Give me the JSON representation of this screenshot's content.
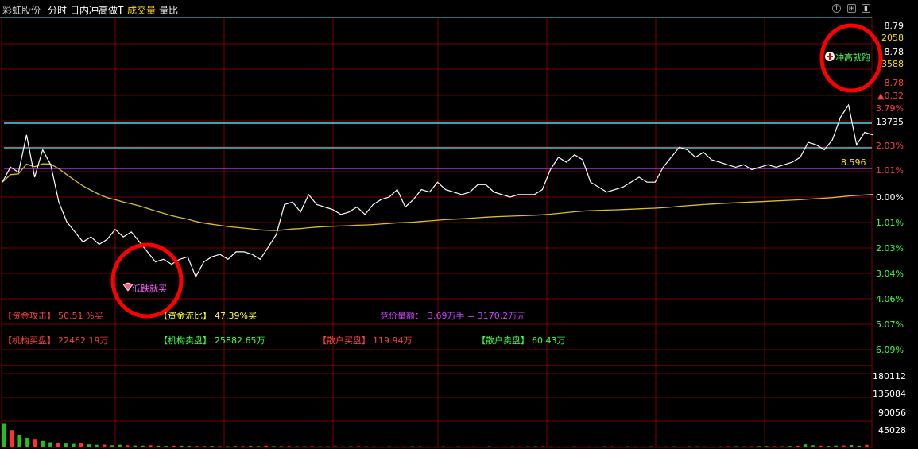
{
  "header": {
    "stock_name": "彩虹股份",
    "tabs": [
      "分时",
      "日内冲高做T",
      "成交量",
      "量比"
    ],
    "tab_colors": [
      "#ffffff",
      "#ffffff",
      "#ffdd00",
      "#ffffff"
    ]
  },
  "overlay_signals": {
    "high_signal": "冲高就跑",
    "low_signal": "低跌就买"
  },
  "info_rows": {
    "row1": [
      {
        "label": "【资金攻击】",
        "value": "50.51 %买",
        "color": "#ff4040"
      },
      {
        "label": "【资金流比】",
        "value": "47.39%买",
        "color": "#ffff40"
      },
      {
        "label": "竞价量额：",
        "value": "3.69万手 = 3170.2万元",
        "color": "#d040ff"
      }
    ],
    "row2": [
      {
        "label": "【机构买盘】",
        "value": "22462.19万",
        "color": "#ff4040"
      },
      {
        "label": "【机构卖盘】",
        "value": "25882.65万",
        "color": "#40ff40"
      },
      {
        "label": "【散户买盘】",
        "value": "119.94万",
        "color": "#ff4040"
      },
      {
        "label": "【散户卖盘】",
        "value": "60.43万",
        "color": "#40ff40"
      }
    ]
  },
  "right_axis": {
    "top_labels": [
      {
        "text": "8.79",
        "color": "#ffffff"
      },
      {
        "text": "2058",
        "color": "#ffdd00"
      },
      {
        "text": "8.78",
        "color": "#ffffff"
      },
      {
        "text": "3588",
        "color": "#ffdd00"
      },
      {
        "text": "8.78",
        "color": "#ff4040"
      },
      {
        "text": "▲0.32",
        "color": "#ff4040"
      },
      {
        "text": "3.79%",
        "color": "#ff4040"
      },
      {
        "text": "13735",
        "color": "#ffffff"
      }
    ],
    "pct_labels": [
      {
        "text": "2.03%",
        "color": "#ff4040"
      },
      {
        "text": "1.01%",
        "color": "#ff4040"
      },
      {
        "text": "0.00%",
        "color": "#ffffff"
      },
      {
        "text": "1.01%",
        "color": "#40ff40"
      },
      {
        "text": "2.03%",
        "color": "#40ff40"
      },
      {
        "text": "3.04%",
        "color": "#40ff40"
      },
      {
        "text": "4.06%",
        "color": "#40ff40"
      },
      {
        "text": "5.07%",
        "color": "#40ff40"
      },
      {
        "text": "6.09%",
        "color": "#40ff40"
      }
    ],
    "volume_labels": [
      "180112",
      "135084",
      "90056",
      "45028"
    ],
    "avg_price_label": "8.596"
  },
  "colors": {
    "grid": "#7a0000",
    "price_line": "#ffffff",
    "avg_line": "#d8c020",
    "cyan_line": "#40e0f0",
    "magenta_line": "#c040ff",
    "circle": "#ff0000",
    "volume_bar": "#20c020"
  },
  "chart_data": {
    "type": "line",
    "y_unit": "% change vs previous close",
    "ylim": [
      -6.09,
      3.9
    ],
    "reference_levels_pct": {
      "cyan_upper": 2.97,
      "cyan_lower": 1.98,
      "magenta": 1.15
    },
    "price_pct_series": [
      0.6,
      1.2,
      1.0,
      2.5,
      0.8,
      1.9,
      1.3,
      -0.2,
      -1.0,
      -1.4,
      -1.8,
      -1.6,
      -1.9,
      -1.7,
      -1.3,
      -1.6,
      -1.4,
      -1.8,
      -2.2,
      -2.6,
      -2.5,
      -2.7,
      -2.5,
      -2.4,
      -3.2,
      -2.6,
      -2.4,
      -2.3,
      -2.5,
      -2.2,
      -2.2,
      -2.3,
      -2.5,
      -2.0,
      -1.5,
      -0.3,
      -0.2,
      -0.6,
      0.1,
      -0.3,
      -0.4,
      -0.5,
      -0.7,
      -0.6,
      -0.4,
      -0.7,
      -0.3,
      -0.1,
      0.0,
      0.3,
      -0.4,
      -0.1,
      0.3,
      0.2,
      0.6,
      0.3,
      0.2,
      0.1,
      0.2,
      0.5,
      0.5,
      0.2,
      0.1,
      0.0,
      0.1,
      0.1,
      0.1,
      0.3,
      1.1,
      1.6,
      1.4,
      1.7,
      1.5,
      0.6,
      0.4,
      0.2,
      0.3,
      0.4,
      0.6,
      0.8,
      0.6,
      0.6,
      1.2,
      1.6,
      2.0,
      1.9,
      1.6,
      1.8,
      1.5,
      1.4,
      1.3,
      1.2,
      1.3,
      1.1,
      1.2,
      1.3,
      1.2,
      1.3,
      1.4,
      1.6,
      2.2,
      2.1,
      1.9,
      2.3,
      3.2,
      3.7,
      2.1,
      2.6,
      2.5
    ]
  },
  "volume_data": {
    "max": 180112,
    "bars": [
      56000,
      40000,
      28000,
      22000,
      18000,
      15000,
      12000,
      10000,
      9000,
      8000,
      9000,
      7000,
      6000,
      6500,
      5000,
      6000,
      5000,
      4500,
      4000,
      5000,
      4000,
      3500,
      4000,
      3800,
      3500,
      3200,
      3000,
      3400,
      3000,
      2800,
      3200,
      3000,
      3500,
      3000,
      4000,
      3000,
      2800,
      3000,
      2600,
      2500,
      2800,
      2400,
      2300,
      2600,
      2200,
      2500,
      2800,
      2400,
      2200,
      2100,
      2300,
      2000,
      2200,
      2600,
      2400,
      2100,
      2000,
      2300,
      2100,
      2400,
      2000,
      2200,
      1900,
      2500,
      2100,
      2000,
      2300,
      2200,
      2400,
      2600,
      2500,
      2200,
      2100,
      2000,
      2300,
      1900,
      2200,
      2100,
      2500,
      2300,
      2000,
      2400,
      2200,
      2100,
      2300,
      2000,
      2200,
      2400,
      2100,
      2500,
      2300,
      2200,
      2100,
      2400,
      2600,
      2800,
      2300,
      2500,
      3000,
      3200,
      2800,
      2600,
      3400,
      3800,
      7000,
      5000,
      4000,
      3500,
      4200,
      4500,
      5500,
      4000,
      6000
    ]
  }
}
